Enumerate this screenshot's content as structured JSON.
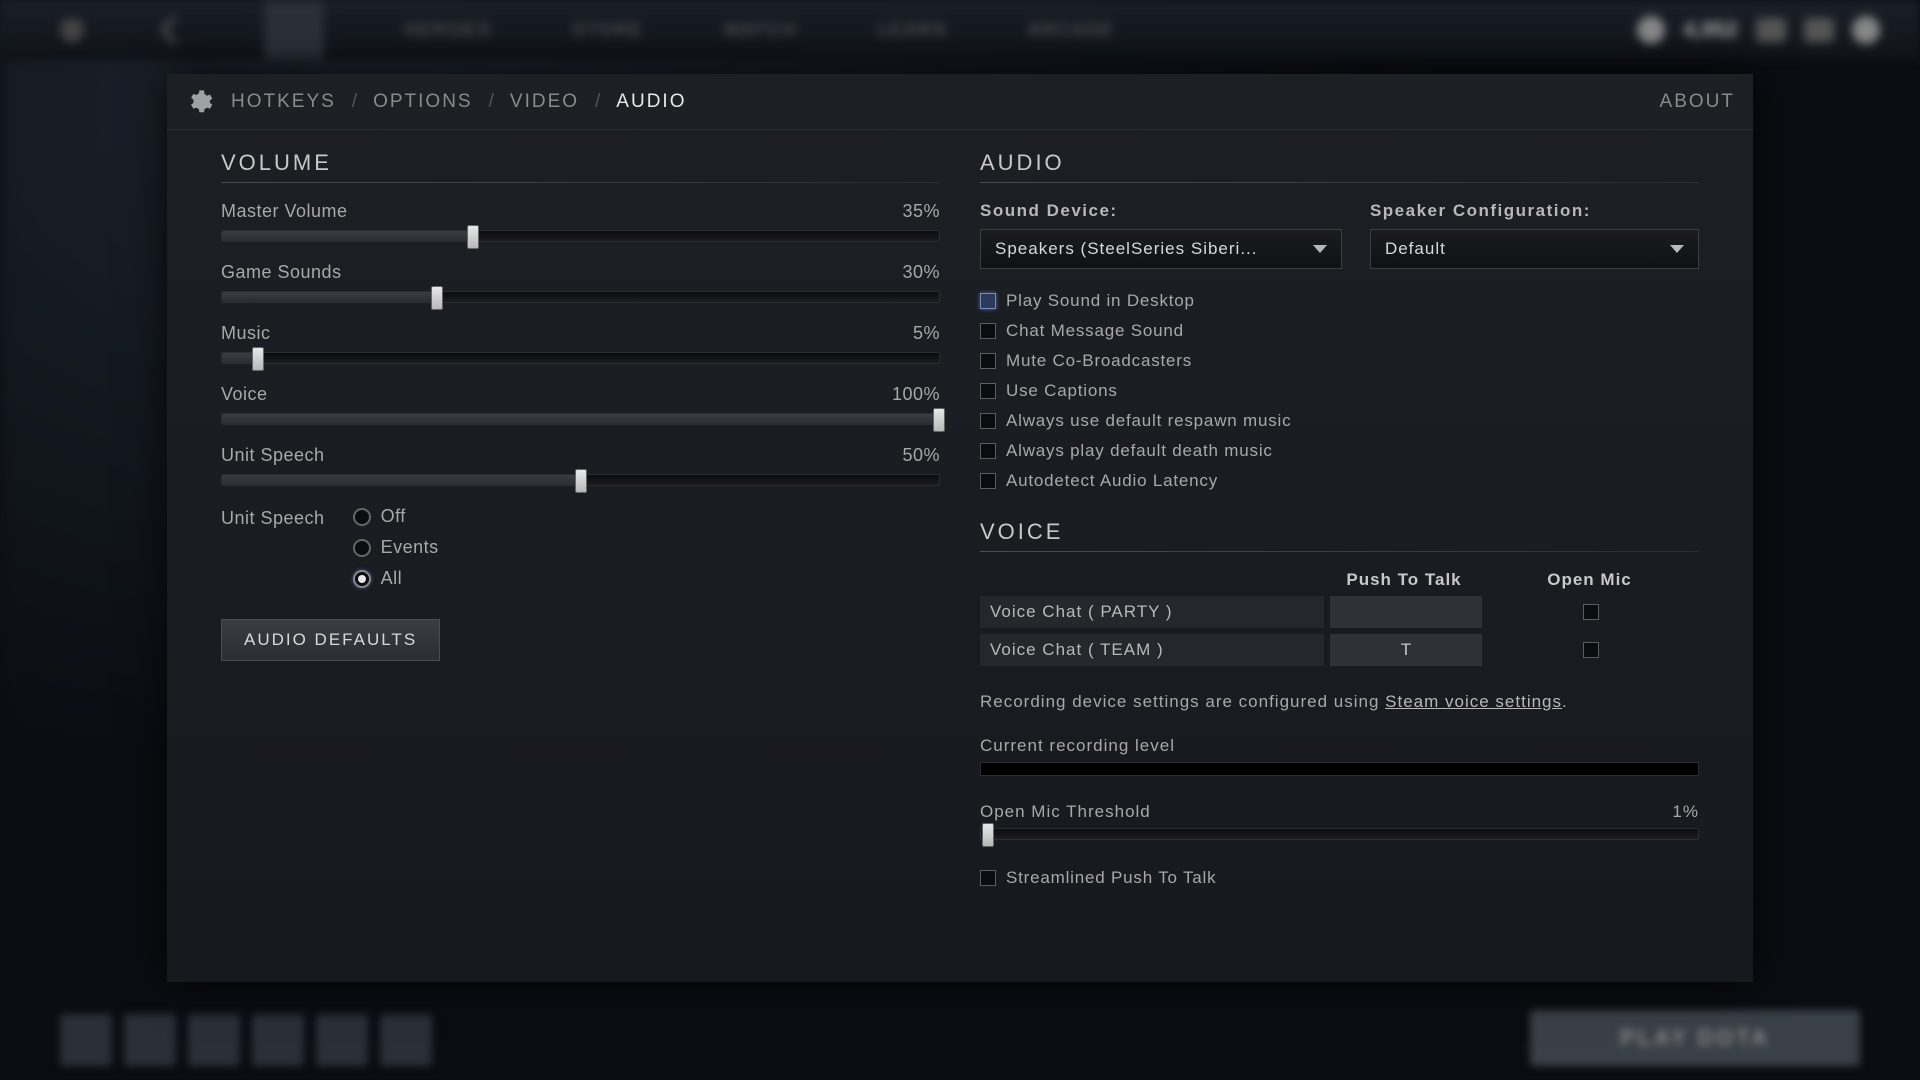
{
  "tabs": {
    "hotkeys": "HOTKEYS",
    "options": "OPTIONS",
    "video": "VIDEO",
    "audio": "AUDIO",
    "about": "ABOUT"
  },
  "volume": {
    "title": "VOLUME",
    "sliders": [
      {
        "label": "Master Volume",
        "value": 35,
        "display": "35%"
      },
      {
        "label": "Game Sounds",
        "value": 30,
        "display": "30%"
      },
      {
        "label": "Music",
        "value": 5,
        "display": "5%"
      },
      {
        "label": "Voice",
        "value": 100,
        "display": "100%"
      },
      {
        "label": "Unit Speech",
        "value": 50,
        "display": "50%"
      }
    ],
    "unit_speech_label": "Unit Speech",
    "unit_speech_opts": [
      "Off",
      "Events",
      "All"
    ],
    "unit_speech_sel": 2,
    "defaults_btn": "AUDIO DEFAULTS"
  },
  "audio": {
    "title": "AUDIO",
    "sound_device_label": "Sound Device:",
    "sound_device_value": "Speakers (SteelSeries Siberi...",
    "speaker_label": "Speaker Configuration:",
    "speaker_value": "Default",
    "checks": [
      {
        "label": "Play Sound in Desktop",
        "hl": true
      },
      {
        "label": "Chat Message Sound"
      },
      {
        "label": "Mute Co-Broadcasters"
      },
      {
        "label": "Use Captions"
      },
      {
        "label": "Always use default respawn music"
      },
      {
        "label": "Always play default death music"
      },
      {
        "label": "Autodetect Audio Latency"
      }
    ]
  },
  "voice": {
    "title": "VOICE",
    "col_ptt": "Push To Talk",
    "col_open": "Open Mic",
    "rows": [
      {
        "label": "Voice Chat ( PARTY )",
        "key": ""
      },
      {
        "label": "Voice Chat ( TEAM )",
        "key": "T"
      }
    ],
    "rec_note_pre": "Recording device settings are configured using ",
    "rec_note_link": "Steam voice settings",
    "rec_note_post": ".",
    "rec_level_label": "Current recording level",
    "thresh_label": "Open Mic Threshold",
    "thresh_value": 1,
    "thresh_display": "1%",
    "streamlined_label": "Streamlined Push To Talk"
  }
}
